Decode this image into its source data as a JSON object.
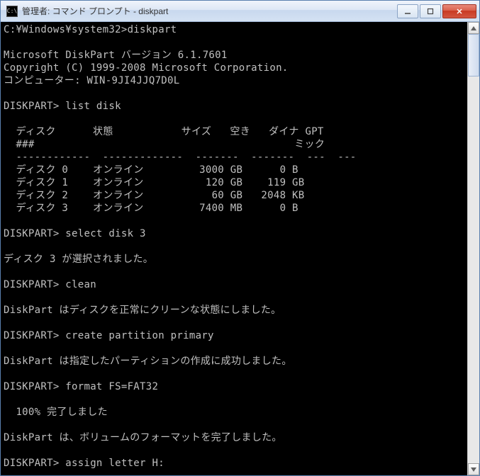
{
  "window": {
    "title": "管理者: コマンド プロンプト - diskpart",
    "icon_label": "C:\\"
  },
  "lines": [
    "C:¥Windows¥system32>diskpart",
    "",
    "Microsoft DiskPart バージョン 6.1.7601",
    "Copyright (C) 1999-2008 Microsoft Corporation.",
    "コンピューター: WIN-9JI4JJQ7D0L",
    "",
    "DISKPART> list disk",
    "",
    "  ディスク      状態           サイズ   空き   ダイナ GPT",
    "  ###                                          ミック",
    "  ------------  -------------  -------  -------  ---  ---",
    "  ディスク 0    オンライン         3000 GB      0 B",
    "  ディスク 1    オンライン          120 GB    119 GB",
    "  ディスク 2    オンライン           60 GB   2048 KB",
    "  ディスク 3    オンライン         7400 MB      0 B",
    "",
    "DISKPART> select disk 3",
    "",
    "ディスク 3 が選択されました。",
    "",
    "DISKPART> clean",
    "",
    "DiskPart はディスクを正常にクリーンな状態にしました。",
    "",
    "DISKPART> create partition primary",
    "",
    "DiskPart は指定したパーティションの作成に成功しました。",
    "",
    "DISKPART> format FS=FAT32",
    "",
    "  100% 完了しました",
    "",
    "DiskPart は、ボリュームのフォーマットを完了しました。",
    "",
    "DISKPART> assign letter H:"
  ]
}
